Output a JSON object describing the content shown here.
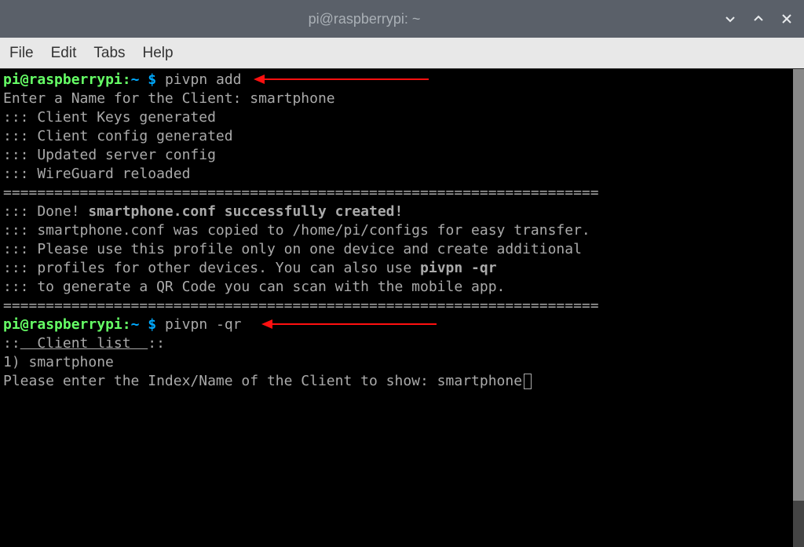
{
  "window": {
    "title": "pi@raspberrypi: ~"
  },
  "menubar": {
    "items": [
      "File",
      "Edit",
      "Tabs",
      "Help"
    ]
  },
  "terminal": {
    "prompt1": {
      "user": "pi",
      "host": "raspberrypi",
      "path": "~",
      "dollar": "$",
      "command": "pivpn add"
    },
    "lines1": {
      "l1": "Enter a Name for the Client: smartphone",
      "l2": "::: Client Keys generated",
      "l3": "::: Client config generated",
      "l4": "::: Updated server config",
      "l5": "::: WireGuard reloaded",
      "l6": "======================================================================",
      "l7_prefix": "::: Done! ",
      "l7_bold": "smartphone.conf successfully created!",
      "l8": "::: smartphone.conf was copied to /home/pi/configs for easy transfer.",
      "l9": "::: Please use this profile only on one device and create additional",
      "l10_prefix": "::: profiles for other devices. You can also use ",
      "l10_bold": "pivpn -qr",
      "l11": "::: to generate a QR Code you can scan with the mobile app.",
      "l12": "======================================================================"
    },
    "prompt2": {
      "user": "pi",
      "host": "raspberrypi",
      "path": "~",
      "dollar": "$",
      "command": "pivpn -qr"
    },
    "lines2": {
      "l1_prefix": "::",
      "l1_underlined": "  Client list  ",
      "l1_suffix": "::",
      "l2": "1) smartphone",
      "l3": "Please enter the Index/Name of the Client to show: smartphone"
    }
  }
}
